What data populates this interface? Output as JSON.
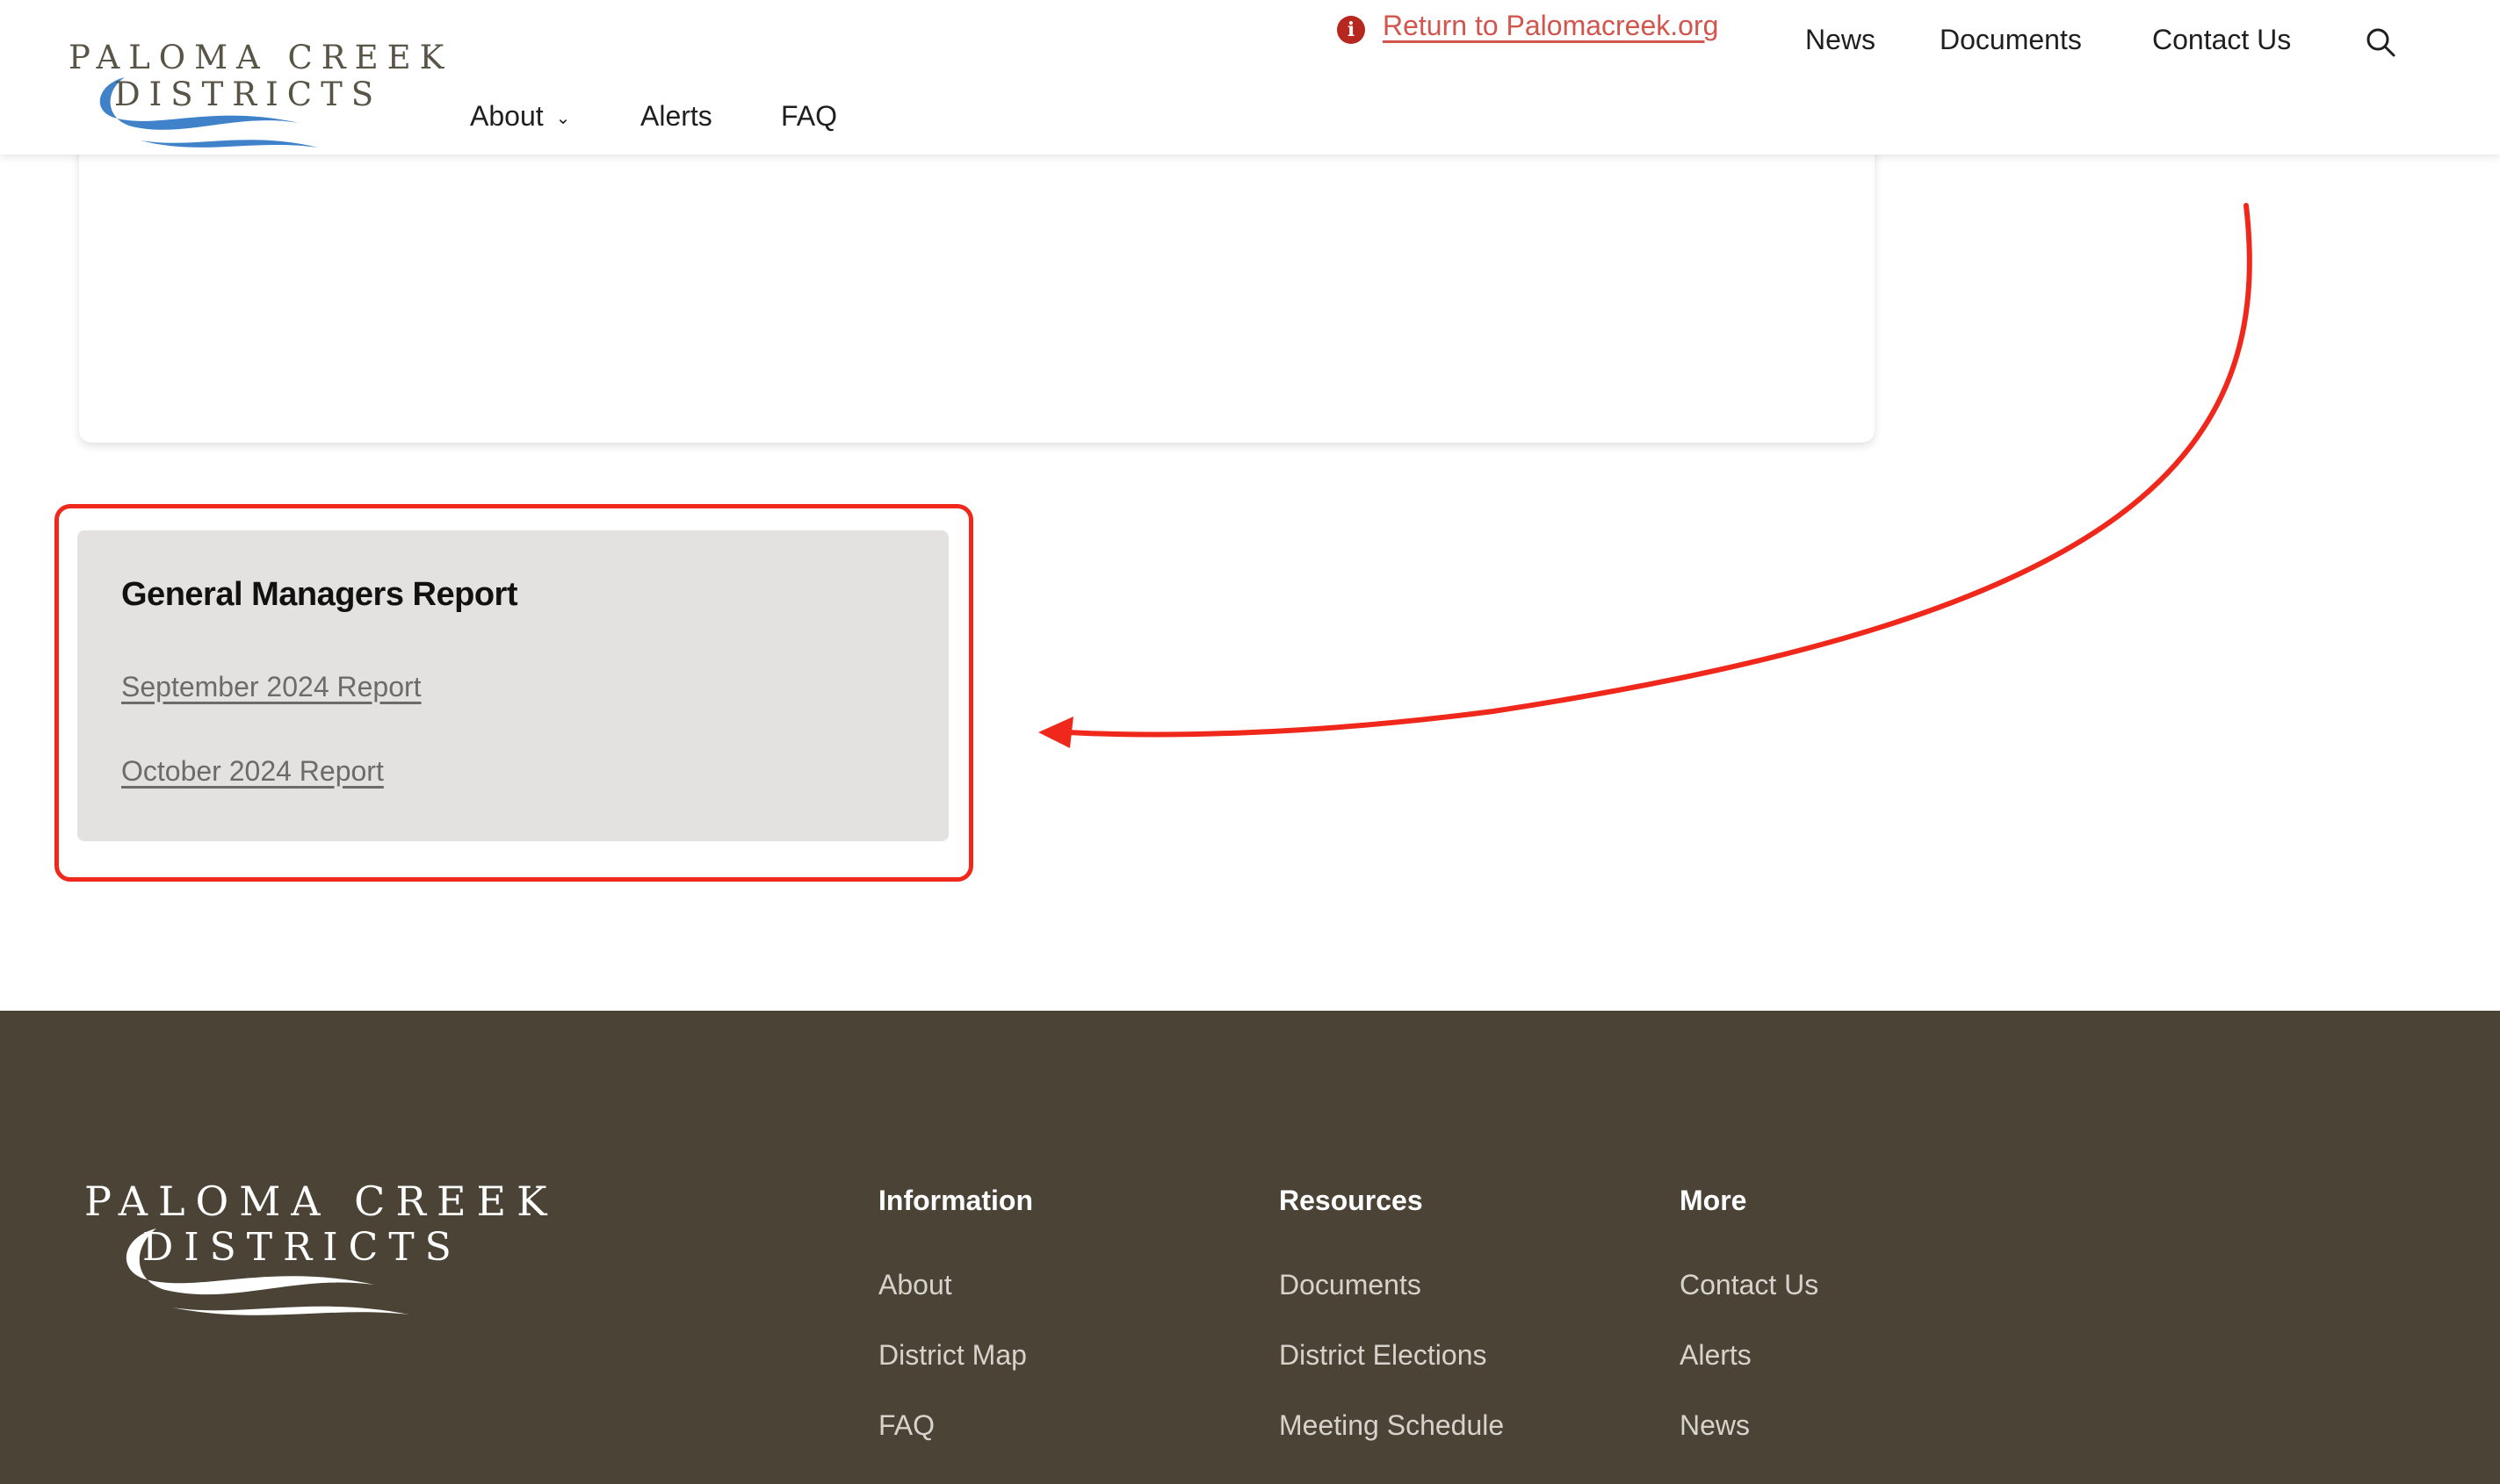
{
  "header": {
    "logo": {
      "line1": "PALOMA CREEK",
      "line2": "DISTRICTS"
    },
    "alert": {
      "icon": "info-icon",
      "icon_glyph": "i",
      "link_text": "Return to Palomacreek.org"
    },
    "top_nav": [
      "News",
      "Documents",
      "Contact Us"
    ],
    "sub_nav": {
      "about": "About",
      "alerts": "Alerts",
      "faq": "FAQ"
    },
    "search_icon": "search-icon"
  },
  "main": {
    "report_card": {
      "title": "General Managers Report",
      "links": [
        "September 2024 Report",
        "October 2024 Report"
      ]
    },
    "annotation": {
      "color": "#f0281c"
    }
  },
  "footer": {
    "logo": {
      "line1": "PALOMA CREEK",
      "line2": "DISTRICTS"
    },
    "columns": [
      {
        "heading": "Information",
        "links": [
          "About",
          "District Map",
          "FAQ"
        ]
      },
      {
        "heading": "Resources",
        "links": [
          "Documents",
          "District Elections",
          "Meeting Schedule"
        ]
      },
      {
        "heading": "More",
        "links": [
          "Contact Us",
          "Alerts",
          "News"
        ]
      }
    ]
  },
  "colors": {
    "footer_bg": "#4a4336",
    "card_bg": "#e3e2e0",
    "alert_link": "#d2554e",
    "logo_blue": "#3f82c9"
  }
}
